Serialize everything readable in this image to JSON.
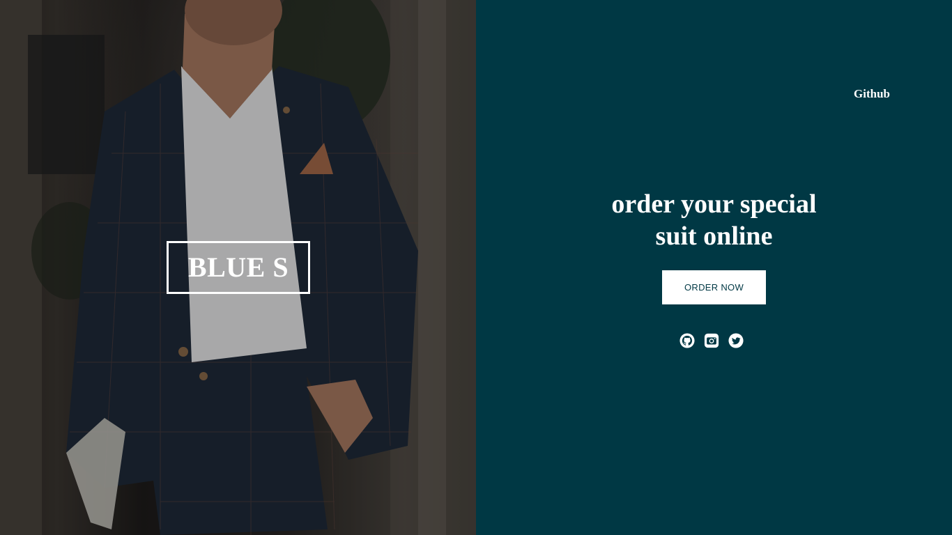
{
  "brand": {
    "logo_text": "BLUE S"
  },
  "nav": {
    "github_label": "Github"
  },
  "hero": {
    "headline_line1": "order your special",
    "headline_line2": "suit online",
    "cta_label": "ORDER NOW"
  },
  "socials": [
    {
      "icon": "github-icon"
    },
    {
      "icon": "instagram-icon"
    },
    {
      "icon": "twitter-icon"
    }
  ],
  "colors": {
    "panel_bg": "#003844",
    "text": "#ffffff",
    "button_bg": "#ffffff",
    "button_text": "#003844"
  }
}
